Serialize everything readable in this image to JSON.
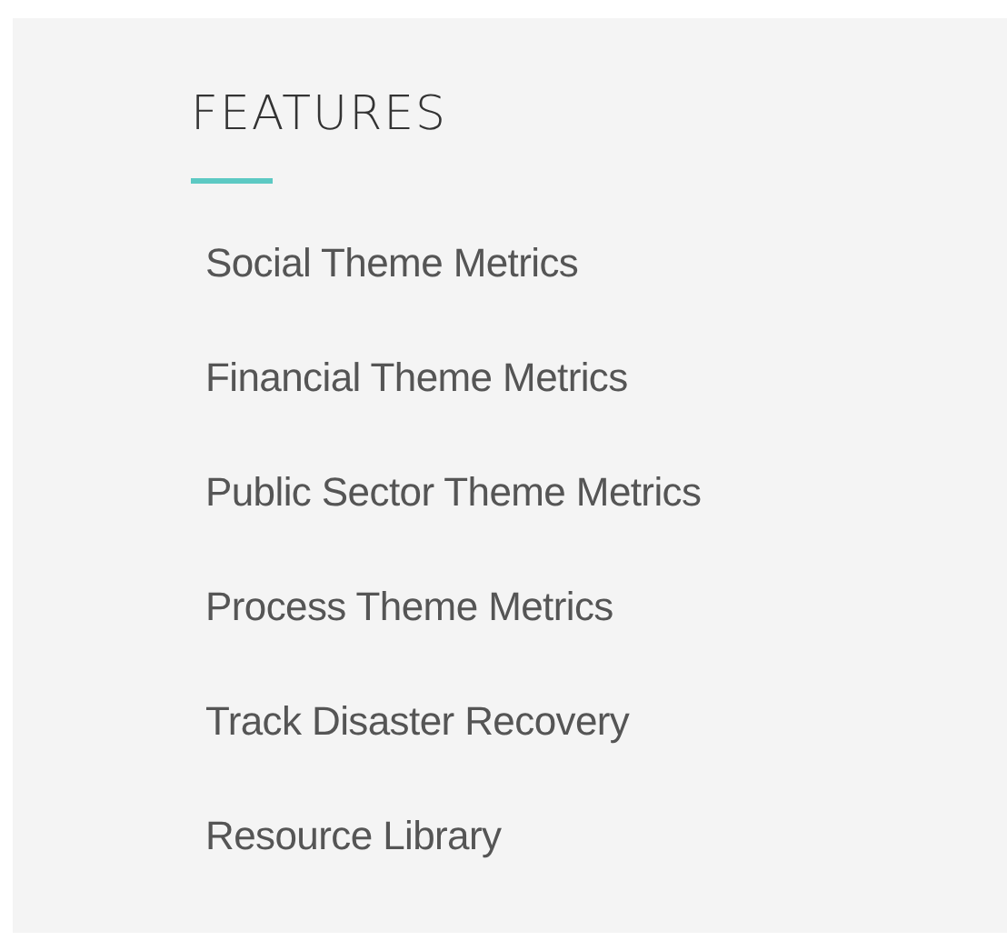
{
  "heading": "FEATURES",
  "links": [
    {
      "label": "Social Theme Metrics"
    },
    {
      "label": "Financial Theme Metrics"
    },
    {
      "label": "Public Sector Theme Metrics"
    },
    {
      "label": "Process Theme Metrics"
    },
    {
      "label": "Track Disaster Recovery"
    },
    {
      "label": "Resource Library"
    }
  ]
}
